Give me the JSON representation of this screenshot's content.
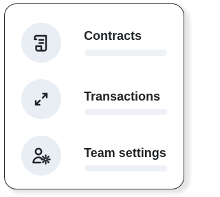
{
  "menu": {
    "items": [
      {
        "label": "Contracts",
        "icon": "contract-scroll-icon"
      },
      {
        "label": "Transactions",
        "icon": "arrows-diagonal-icon"
      },
      {
        "label": "Team settings",
        "icon": "user-gear-icon"
      }
    ]
  },
  "colors": {
    "icon_background": "#e9edf4",
    "text": "#1f2326",
    "placeholder_bar": "#eef1f5",
    "card_border": "#262a2f"
  }
}
